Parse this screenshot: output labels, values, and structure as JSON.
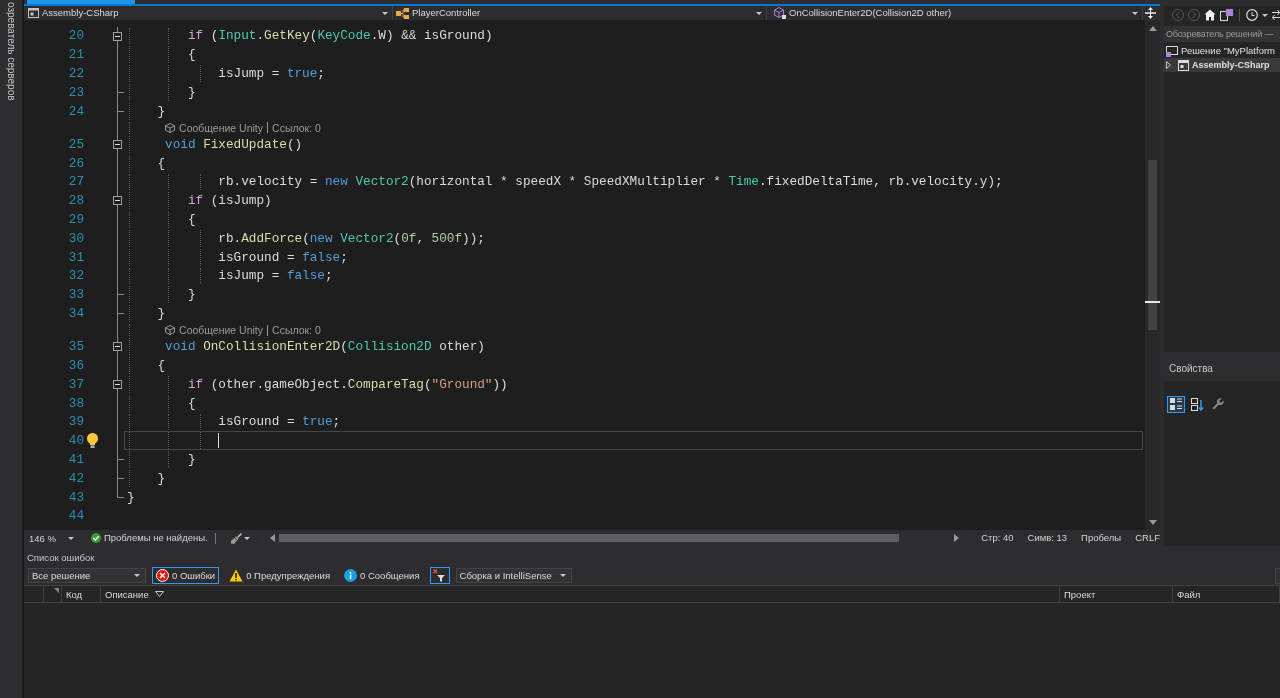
{
  "side_tab": {
    "label": "озреватель серверов"
  },
  "document_tab": {
    "selected": true
  },
  "navigation_bar": {
    "project": "Assembly-CSharp",
    "type": "PlayerController",
    "member": "OnCollisionEnter2D(Collision2D other)"
  },
  "editor": {
    "lines": [
      {
        "kind": "code",
        "number": "20",
        "outline": {
          "kind": "open"
        },
        "current": false,
        "lightbulb": false,
        "tokens": [
          {
            "text": "        if",
            "kind": "ctl"
          },
          {
            "text": " (",
            "kind": "p"
          },
          {
            "text": "Input",
            "kind": "type"
          },
          {
            "text": ".",
            "kind": "p"
          },
          {
            "text": "GetKey",
            "kind": "fn"
          },
          {
            "text": "(",
            "kind": "p"
          },
          {
            "text": "KeyCode",
            "kind": "type"
          },
          {
            "text": ".W) && isGround)",
            "kind": "p"
          }
        ]
      },
      {
        "kind": "code",
        "number": "21",
        "outline": {
          "kind": "line"
        },
        "current": false,
        "lightbulb": false,
        "tokens": [
          {
            "text": "        {",
            "kind": "p"
          }
        ]
      },
      {
        "kind": "code",
        "number": "22",
        "outline": {
          "kind": "line"
        },
        "current": false,
        "lightbulb": false,
        "tokens": [
          {
            "text": "            isJump = ",
            "kind": "p"
          },
          {
            "text": "true",
            "kind": "kw"
          },
          {
            "text": ";",
            "kind": "p"
          }
        ]
      },
      {
        "kind": "code",
        "number": "23",
        "outline": {
          "kind": "end"
        },
        "current": false,
        "lightbulb": false,
        "tokens": [
          {
            "text": "        }",
            "kind": "p"
          }
        ]
      },
      {
        "kind": "code",
        "number": "24",
        "outline": {
          "kind": "end"
        },
        "current": false,
        "lightbulb": false,
        "tokens": [
          {
            "text": "    }",
            "kind": "p"
          }
        ]
      },
      {
        "kind": "codelens",
        "outline": {
          "kind": "line"
        },
        "items": [
          "Сообщение Unity",
          "Ссылок: 0"
        ]
      },
      {
        "kind": "code",
        "number": "25",
        "outline": {
          "kind": "open"
        },
        "current": false,
        "lightbulb": false,
        "tokens": [
          {
            "text": "     void ",
            "kind": "kw"
          },
          {
            "text": "FixedUpdate",
            "kind": "fn"
          },
          {
            "text": "()",
            "kind": "p"
          }
        ]
      },
      {
        "kind": "code",
        "number": "26",
        "outline": {
          "kind": "line"
        },
        "current": false,
        "lightbulb": false,
        "tokens": [
          {
            "text": "    {",
            "kind": "p"
          }
        ]
      },
      {
        "kind": "code",
        "number": "27",
        "outline": {
          "kind": "line"
        },
        "current": false,
        "lightbulb": false,
        "tokens": [
          {
            "text": "            rb.velocity = ",
            "kind": "p"
          },
          {
            "text": "new ",
            "kind": "kw"
          },
          {
            "text": "Vector2",
            "kind": "type"
          },
          {
            "text": "(horizontal * speedX * SpeedXMultiplier * ",
            "kind": "p"
          },
          {
            "text": "Time",
            "kind": "type"
          },
          {
            "text": ".fixedDeltaTime, rb.velocity.y);",
            "kind": "p"
          }
        ]
      },
      {
        "kind": "code",
        "number": "28",
        "outline": {
          "kind": "open"
        },
        "current": false,
        "lightbulb": false,
        "tokens": [
          {
            "text": "        if",
            "kind": "ctl"
          },
          {
            "text": " (isJump)",
            "kind": "p"
          }
        ]
      },
      {
        "kind": "code",
        "number": "29",
        "outline": {
          "kind": "line"
        },
        "current": false,
        "lightbulb": false,
        "tokens": [
          {
            "text": "        {",
            "kind": "p"
          }
        ]
      },
      {
        "kind": "code",
        "number": "30",
        "outline": {
          "kind": "line"
        },
        "current": false,
        "lightbulb": false,
        "tokens": [
          {
            "text": "            rb.",
            "kind": "p"
          },
          {
            "text": "AddForce",
            "kind": "fn"
          },
          {
            "text": "(",
            "kind": "p"
          },
          {
            "text": "new ",
            "kind": "kw"
          },
          {
            "text": "Vector2",
            "kind": "type"
          },
          {
            "text": "(",
            "kind": "p"
          },
          {
            "text": "0f",
            "kind": "num"
          },
          {
            "text": ", ",
            "kind": "p"
          },
          {
            "text": "500f",
            "kind": "num"
          },
          {
            "text": "));",
            "kind": "p"
          }
        ]
      },
      {
        "kind": "code",
        "number": "31",
        "outline": {
          "kind": "line"
        },
        "current": false,
        "lightbulb": false,
        "tokens": [
          {
            "text": "            isGround = ",
            "kind": "p"
          },
          {
            "text": "false",
            "kind": "kw"
          },
          {
            "text": ";",
            "kind": "p"
          }
        ]
      },
      {
        "kind": "code",
        "number": "32",
        "outline": {
          "kind": "line"
        },
        "current": false,
        "lightbulb": false,
        "tokens": [
          {
            "text": "            isJump = ",
            "kind": "p"
          },
          {
            "text": "false",
            "kind": "kw"
          },
          {
            "text": ";",
            "kind": "p"
          }
        ]
      },
      {
        "kind": "code",
        "number": "33",
        "outline": {
          "kind": "end"
        },
        "current": false,
        "lightbulb": false,
        "tokens": [
          {
            "text": "        }",
            "kind": "p"
          }
        ]
      },
      {
        "kind": "code",
        "number": "34",
        "outline": {
          "kind": "end"
        },
        "current": false,
        "lightbulb": false,
        "tokens": [
          {
            "text": "    }",
            "kind": "p"
          }
        ]
      },
      {
        "kind": "codelens",
        "outline": {
          "kind": "line"
        },
        "items": [
          "Сообщение Unity",
          "Ссылок: 0"
        ]
      },
      {
        "kind": "code",
        "number": "35",
        "outline": {
          "kind": "open"
        },
        "current": false,
        "lightbulb": false,
        "tokens": [
          {
            "text": "     void ",
            "kind": "kw"
          },
          {
            "text": "OnCollisionEnter2D",
            "kind": "fn"
          },
          {
            "text": "(",
            "kind": "p"
          },
          {
            "text": "Collision2D",
            "kind": "type"
          },
          {
            "text": " other)",
            "kind": "p"
          }
        ]
      },
      {
        "kind": "code",
        "number": "36",
        "outline": {
          "kind": "line"
        },
        "current": false,
        "lightbulb": false,
        "tokens": [
          {
            "text": "    {",
            "kind": "p"
          }
        ]
      },
      {
        "kind": "code",
        "number": "37",
        "outline": {
          "kind": "open"
        },
        "current": false,
        "lightbulb": false,
        "tokens": [
          {
            "text": "        if",
            "kind": "ctl"
          },
          {
            "text": " (other.gameObject.",
            "kind": "p"
          },
          {
            "text": "CompareTag",
            "kind": "fn"
          },
          {
            "text": "(",
            "kind": "p"
          },
          {
            "text": "\"Ground\"",
            "kind": "str"
          },
          {
            "text": "))",
            "kind": "p"
          }
        ]
      },
      {
        "kind": "code",
        "number": "38",
        "outline": {
          "kind": "line"
        },
        "current": false,
        "lightbulb": false,
        "tokens": [
          {
            "text": "        {",
            "kind": "p"
          }
        ]
      },
      {
        "kind": "code",
        "number": "39",
        "outline": {
          "kind": "line"
        },
        "current": false,
        "lightbulb": false,
        "tokens": [
          {
            "text": "            isGround = ",
            "kind": "p"
          },
          {
            "text": "true",
            "kind": "kw"
          },
          {
            "text": ";",
            "kind": "p"
          }
        ]
      },
      {
        "kind": "code",
        "number": "40",
        "outline": {
          "kind": "line"
        },
        "current": true,
        "lightbulb": true
      },
      {
        "kind": "code",
        "number": "41",
        "outline": {
          "kind": "end"
        },
        "current": false,
        "lightbulb": false,
        "tokens": [
          {
            "text": "        }",
            "kind": "p"
          }
        ]
      },
      {
        "kind": "code",
        "number": "42",
        "outline": {
          "kind": "end"
        },
        "current": false,
        "lightbulb": false,
        "tokens": [
          {
            "text": "    }",
            "kind": "p"
          }
        ]
      },
      {
        "kind": "code",
        "number": "43",
        "outline": {
          "kind": "end"
        },
        "current": false,
        "lightbulb": false,
        "tokens": [
          {
            "text": "}",
            "kind": "p"
          }
        ]
      },
      {
        "kind": "code",
        "number": "44",
        "current": false,
        "lightbulb": false
      }
    ]
  },
  "status_bar": {
    "zoom": "146 %",
    "issues": "Проблемы не найдены.",
    "line": "Стр: 40",
    "column": "Симв: 13",
    "indentation": "Пробелы",
    "line_endings": "CRLF"
  },
  "solution_explorer": {
    "search": {
      "placeholder": "Обозреватель решений —"
    },
    "tree": [
      {
        "kind": "solution",
        "label": "Решение \"MyPlatform",
        "startup": false,
        "selected": false,
        "children": [
          {
            "kind": "project",
            "label": "Assembly-CSharp",
            "startup": true,
            "selected": true,
            "expanded": false
          }
        ]
      }
    ]
  },
  "properties": {
    "title": "Свойства",
    "tools": [
      {
        "kind": "categorized",
        "selected": true
      },
      {
        "kind": "alphabetical",
        "selected": false
      },
      {
        "kind": "pages",
        "selected": false
      }
    ]
  },
  "error_list": {
    "title": "Список ошибок",
    "scope": "Все решение",
    "filters": [
      {
        "kind": "error",
        "label": "0 Ошибки",
        "selected": true
      },
      {
        "kind": "warning",
        "label": "0 Предупреждения",
        "selected": false
      },
      {
        "kind": "info",
        "label": "0 Сообщения",
        "selected": false
      }
    ],
    "filter_toggle": {
      "selected": true
    },
    "source": "Сборка и IntelliSense",
    "columns": [
      {
        "label": "Код",
        "sorted": false
      },
      {
        "label": "Описание",
        "sorted": true
      },
      {
        "label": "Проект",
        "sorted": false
      },
      {
        "label": "Файл",
        "sorted": false
      }
    ]
  }
}
